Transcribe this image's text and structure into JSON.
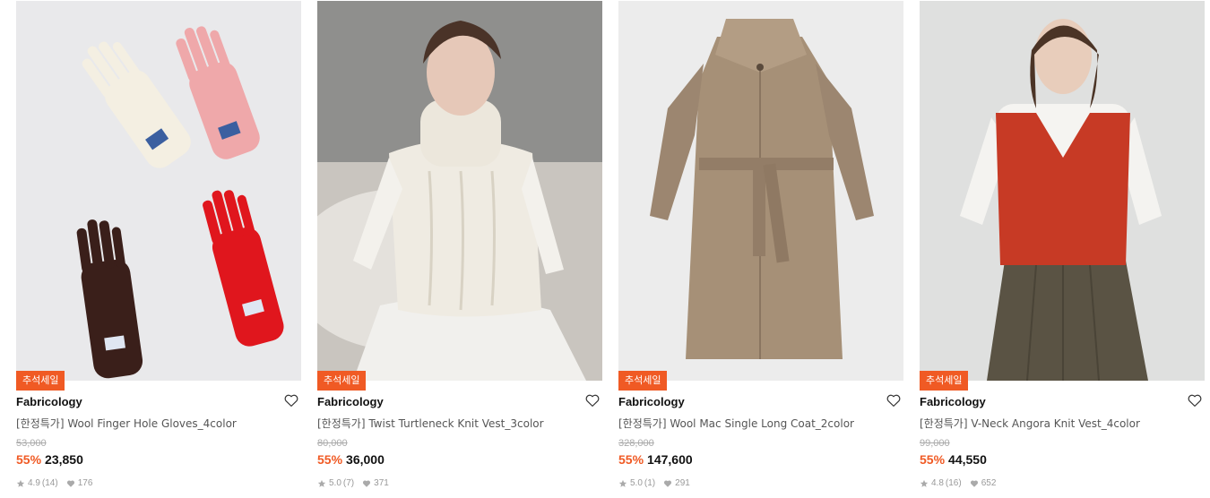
{
  "colors": {
    "accent": "#f05a24",
    "muted": "#999999"
  },
  "products": [
    {
      "badge": "추석세일",
      "brand": "Fabricology",
      "title": "[한정특가] Wool Finger Hole Gloves_4color",
      "original_price": "53,000",
      "discount": "55%",
      "price": "23,850",
      "rating": "4.9",
      "reviews": "(14)",
      "likes": "176",
      "image_icon": "gloves-image"
    },
    {
      "badge": "추석세일",
      "brand": "Fabricology",
      "title": "[한정특가] Twist Turtleneck Knit Vest_3color",
      "original_price": "80,000",
      "discount": "55%",
      "price": "36,000",
      "rating": "5.0",
      "reviews": "(7)",
      "likes": "371",
      "image_icon": "turtleneck-vest-image"
    },
    {
      "badge": "추석세일",
      "brand": "Fabricology",
      "title": "[한정특가] Wool Mac Single Long Coat_2color",
      "original_price": "328,000",
      "discount": "55%",
      "price": "147,600",
      "rating": "5.0",
      "reviews": "(1)",
      "likes": "291",
      "image_icon": "long-coat-image"
    },
    {
      "badge": "추석세일",
      "brand": "Fabricology",
      "title": "[한정특가] V-Neck Angora Knit Vest_4color",
      "original_price": "99,000",
      "discount": "55%",
      "price": "44,550",
      "rating": "4.8",
      "reviews": "(16)",
      "likes": "652",
      "image_icon": "knit-vest-image"
    }
  ]
}
